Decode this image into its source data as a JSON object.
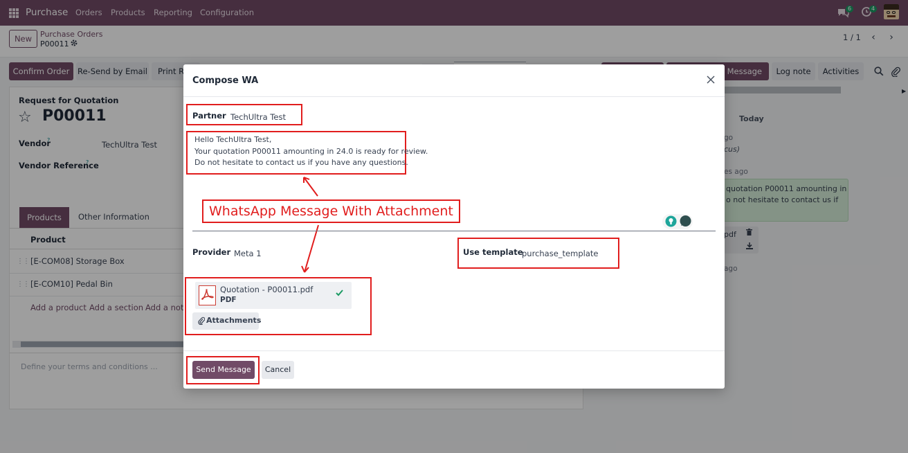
{
  "topbar": {
    "app_name": "Purchase",
    "menu": [
      "Orders",
      "Products",
      "Reporting",
      "Configuration"
    ],
    "chat_badge": "6",
    "activity_badge": "4"
  },
  "control": {
    "new_label": "New",
    "breadcrumb_parent": "Purchase Orders",
    "breadcrumb_current": "P00011",
    "pager": "1 / 1"
  },
  "actions": {
    "confirm": "Confirm Order",
    "resend": "Re-Send by Email",
    "print": "Print R"
  },
  "chatter_buttons": {
    "send_message_partial": "p Message",
    "log_note": "Log note",
    "activities": "Activities"
  },
  "form": {
    "status_label": "Request for Quotation",
    "name": "P00011",
    "vendor_label": "Vendor",
    "vendor_value": "TechUltra Test",
    "vendor_ref_label": "Vendor Reference",
    "help_mark": "?",
    "tabs": [
      "Products",
      "Other Information"
    ],
    "column_product": "Product",
    "lines": [
      "[E-COM08] Storage Box",
      "[E-COM10] Pedal Bin"
    ],
    "add_product": "Add a product",
    "add_section": "Add a section",
    "add_note": "Add a note",
    "terms_placeholder": "Define your terms and conditions ..."
  },
  "chatter": {
    "today": "Today",
    "frag_ago1": "go",
    "frag_cus": "cus)",
    "frag_ago2": "es ago",
    "msg_line1": "quotation P00011 amounting in",
    "msg_line2": "o not hesitate to contact us if",
    "frag_pdf": "pdf",
    "frag_ago3": "ago"
  },
  "dialog": {
    "title": "Compose WA",
    "partner_label": "Partner",
    "partner_value": "TechUltra Test",
    "body_line1": "Hello TechUltra Test,",
    "body_line2": "Your quotation P00011 amounting in 24.0 is ready for review.",
    "body_line3": "Do not hesitate to contact us if you have any questions.",
    "annotation": "WhatsApp Message With Attachment",
    "provider_label": "Provider",
    "provider_value": "Meta 1",
    "template_label": "Use template",
    "template_value": "purchase_template",
    "attachment_name": "Quotation - P00011.pdf",
    "attachment_type": "PDF",
    "attachments_button": "Attachments",
    "send_button": "Send Message",
    "cancel_button": "Cancel"
  },
  "colors": {
    "brand": "#714b67",
    "annotation_red": "#e11d1d",
    "success": "#1b9a63"
  }
}
